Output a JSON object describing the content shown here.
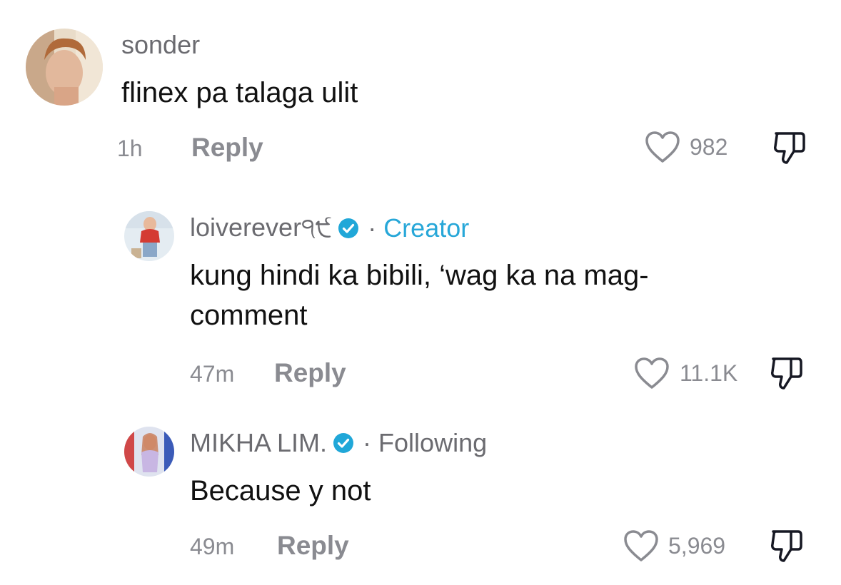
{
  "comments": [
    {
      "username": "sonder",
      "text_lines": [
        "flinex pa talaga ulit"
      ],
      "time": "1h",
      "reply_label": "Reply",
      "like_count": "982"
    },
    {
      "username": "loiverever੧੯",
      "verified": true,
      "badge": "Creator",
      "text_lines": [
        "kung hindi ka bibili, ‘wag ka na mag-",
        "comment"
      ],
      "time": "47m",
      "reply_label": "Reply",
      "like_count": "11.1K"
    },
    {
      "username": "MIKHA LIM.",
      "verified": true,
      "badge": "Following",
      "text_lines": [
        "Because y not"
      ],
      "time": "49m",
      "reply_label": "Reply",
      "like_count": "5,969"
    }
  ],
  "separator": "·",
  "icons": {
    "heart": "heart-icon",
    "dislike": "thumbs-down-icon",
    "verified": "verified-check-icon"
  },
  "colors": {
    "username": "#6b6b70",
    "creator_badge": "#27a7d8",
    "verified": "#20a7d8",
    "meta": "#8a8b91",
    "text": "#111111"
  }
}
